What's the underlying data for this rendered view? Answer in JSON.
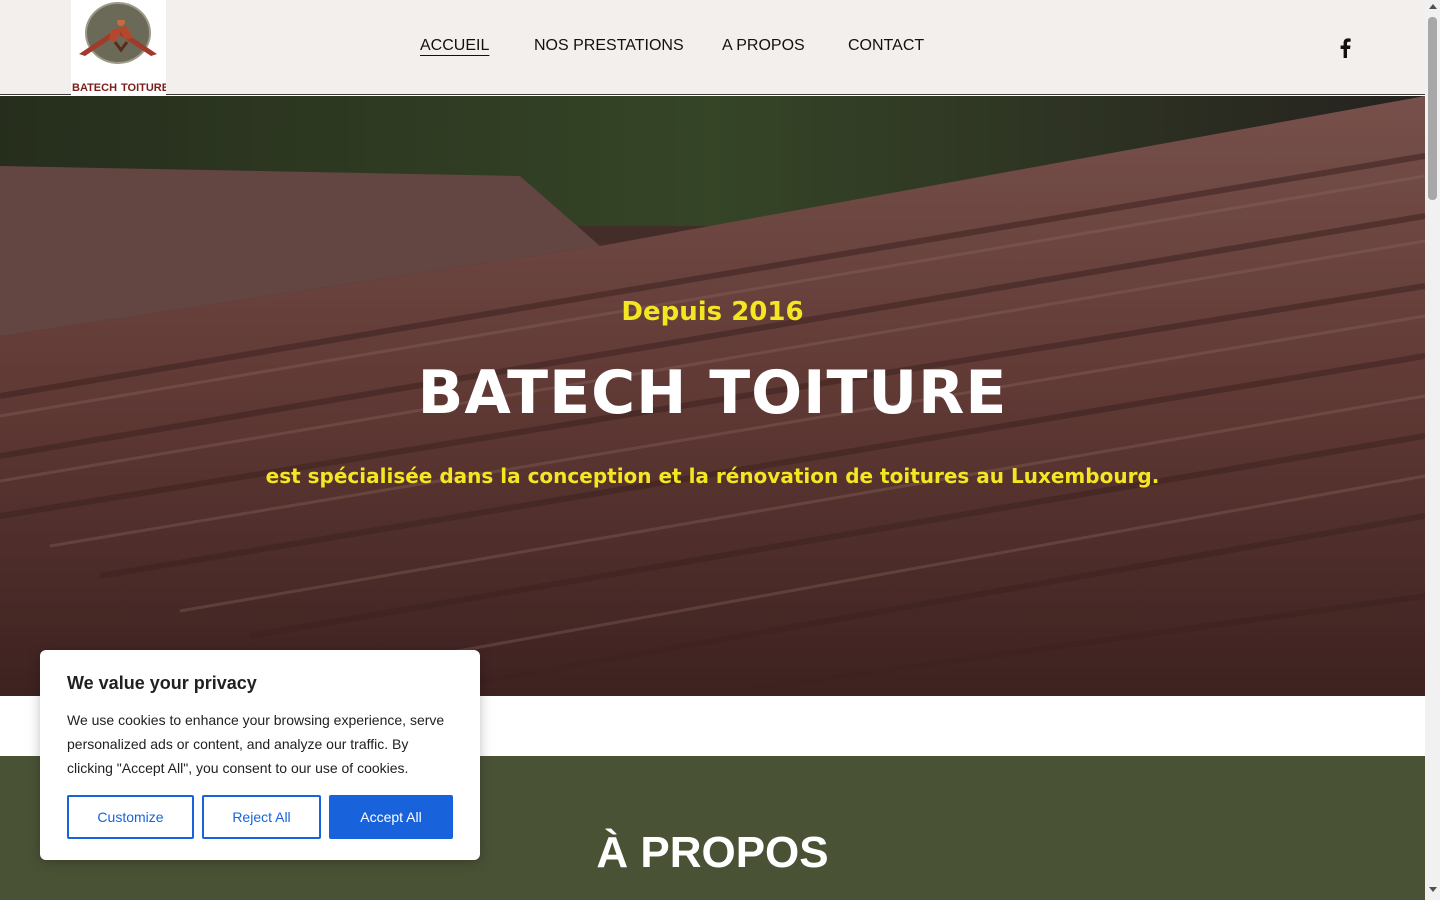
{
  "header": {
    "logo": {
      "line1": "BATECH",
      "line2": "TOITURE"
    },
    "nav": [
      {
        "label": "ACCUEIL",
        "active": true
      },
      {
        "label": "NOS PRESTATIONS",
        "active": false
      },
      {
        "label": "A PROPOS",
        "active": false
      },
      {
        "label": "CONTACT",
        "active": false
      }
    ],
    "social_icon": "facebook-icon"
  },
  "hero": {
    "subtitle": "Depuis 2016",
    "title": "BATECH TOITURE",
    "description": "est spécialisée dans la conception et la rénovation de toitures au Luxembourg."
  },
  "about": {
    "title": "À PROPOS"
  },
  "cookie": {
    "title": "We value your privacy",
    "text": "We use cookies to enhance your browsing experience, serve personalized ads or content, and analyze our traffic. By clicking \"Accept All\", you consent to our use of cookies.",
    "customize_label": "Customize",
    "reject_label": "Reject All",
    "accept_label": "Accept All"
  },
  "colors": {
    "accent_yellow": "#f5e622",
    "about_bg": "#4a5236",
    "header_bg": "#f2efec",
    "cookie_blue": "#1863dc"
  }
}
